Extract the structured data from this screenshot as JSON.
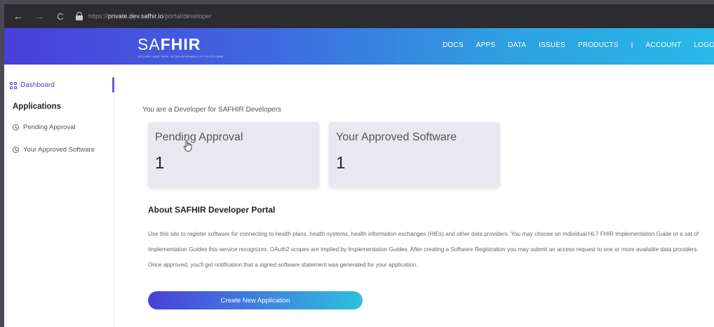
{
  "browser": {
    "url_prefix": "https://",
    "url_host": "private.dev.safhir.io",
    "url_path": "/portal/developer",
    "back_icon": "←",
    "forward_icon": "→",
    "reload_icon": "C"
  },
  "header": {
    "logo_light": "SA",
    "logo_bold": "FHIR",
    "logo_tagline": "SECURE AND FAIR INTEROPERABILITY PLATFORM",
    "nav": [
      "DOCS",
      "APPS",
      "DATA",
      "ISSUES",
      "PRODUCTS",
      "|",
      "ACCOUNT",
      "LOGO"
    ],
    "colors": {
      "gradient_start": "#4a3fd8",
      "gradient_end": "#28b8e6"
    }
  },
  "sidebar": {
    "dashboard": "Dashboard",
    "applications": "Applications",
    "pending": "Pending Approval",
    "approved": "Your Approved Software"
  },
  "main": {
    "intro": "You are a Developer for SAFHIR Developers",
    "cards": [
      {
        "title": "Pending Approval",
        "count": "1"
      },
      {
        "title": "Your Approved Software",
        "count": "1"
      }
    ],
    "about_title": "About SAFHIR Developer Portal",
    "about_body": "Use this site to register software for connecting to health plans, health systems, health information exchanges (HIEs) and other data providers. You may choose an individual HL7 FHIR Implementation Guide or a set of Implementation Guides this service recognizes. OAuth2 scopes are implied by Implementation Guides. After creating a Software Registration you may submit an access request to one or more available data providers. Once approved, you'll get notification that a signed software statement was generated for your application.",
    "create_button": "Create New Application"
  }
}
